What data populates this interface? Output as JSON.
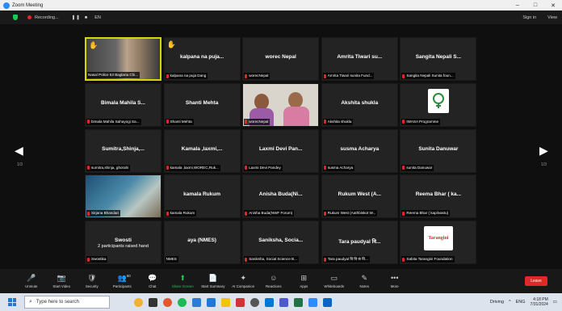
{
  "window": {
    "title": "Zoom Meeting",
    "controls": [
      "–",
      "□",
      "✕"
    ]
  },
  "topbar": {
    "recording": "Recording...",
    "pause": "❚❚",
    "stop": "■",
    "lang": "EN",
    "signin": "Sign in",
    "view": "View"
  },
  "tiles": [
    {
      "name": "",
      "label": "Nasal Police 53 Baglaria Chi...",
      "hand": "✋",
      "video": "person-brown",
      "active": true,
      "muted": false
    },
    {
      "name": "kalpana na puja...",
      "label": "kalpana na puja Dang",
      "hand": "✋",
      "muted": true
    },
    {
      "name": "worec Nepal",
      "label": "worecNepal",
      "muted": true
    },
    {
      "name": "Amrita Tiwari su...",
      "label": "Amrita Tiwari sunita Fund...",
      "muted": true
    },
    {
      "name": "Sangita Nepali S...",
      "label": "Sangita Nepali Sunita foun...",
      "muted": true
    },
    {
      "name": "Bimala Mahila S...",
      "label": "bimala Mahila Sahayogi Sa...",
      "muted": true
    },
    {
      "name": "Shanti Mehta",
      "label": "Shanti Mehta",
      "muted": true
    },
    {
      "name": "",
      "label": "worecNepal",
      "video": "two-women",
      "muted": true
    },
    {
      "name": "Akshita shukla",
      "label": "Akshita shukla",
      "muted": true
    },
    {
      "name": "",
      "label": "IWASA Programme",
      "logo": "iwasa",
      "muted": true
    },
    {
      "name": "Sumitra,Shinja,...",
      "label": "sumitra,shinja, ghorahi",
      "muted": true
    },
    {
      "name": "Kamala ,laxmi,...",
      "label": "kamala ,laxmi,WOREC,Ruk...",
      "muted": true
    },
    {
      "name": "Laxmi Devi Pan...",
      "label": "Laxmi Devi Pandey",
      "muted": true
    },
    {
      "name": "susma Acharya",
      "label": "susma Acharya",
      "muted": true
    },
    {
      "name": "Sunita Danuwar",
      "label": "sunita Danuwar",
      "muted": true
    },
    {
      "name": "",
      "label": "Sirjana Bhandari",
      "video": "room-blue",
      "muted": true
    },
    {
      "name": "kamala Rukum",
      "label": "kamala Rukum",
      "muted": true
    },
    {
      "name": "Anisha Buda(Ni...",
      "label": "Anisha Buda(NWF Forum)",
      "muted": true
    },
    {
      "name": "Rukum West (A...",
      "label": "Rukum West (Aathbiskot W...",
      "muted": true
    },
    {
      "name": "Reema Bhar ( ka...",
      "label": "Reema Bhar ( kapilvastu)",
      "muted": true
    },
    {
      "name": "Swosti",
      "label": "Swostika",
      "muted": true,
      "raise": "2 participants raised hand"
    },
    {
      "name": "aya (NMES)",
      "label": "NMES",
      "muted": false
    },
    {
      "name": "Saniksha, Socia...",
      "label": "Saniksha, Social Science B...",
      "muted": true
    },
    {
      "name": "Tara paudyal वि...",
      "label": "Tara paudyal वि वि कं वि...",
      "muted": true
    },
    {
      "name": "",
      "label": "Sabita Tarangini Foundation",
      "logo": "tarangini",
      "muted": true
    }
  ],
  "tarangini_logo": "Tarangini",
  "nav": {
    "left_page": "1/3",
    "right_page": "1/3"
  },
  "toolbar": [
    {
      "icon": "mic-icon",
      "glyph": "🎤",
      "label": "Unmute"
    },
    {
      "icon": "video-icon",
      "glyph": "📷",
      "label": "Start Video"
    },
    {
      "icon": "security-icon",
      "glyph": "🛡",
      "label": "Security"
    },
    {
      "icon": "participants-icon",
      "glyph": "👥",
      "label": "Participants",
      "count": "60"
    },
    {
      "icon": "chat-icon",
      "glyph": "💬",
      "label": "Chat"
    },
    {
      "icon": "share-screen-icon",
      "glyph": "⬆",
      "label": "Share Screen",
      "green": true
    },
    {
      "icon": "summary-icon",
      "glyph": "📄",
      "label": "Start Summary"
    },
    {
      "icon": "ai-companion-icon",
      "glyph": "✦",
      "label": "AI Companion"
    },
    {
      "icon": "reactions-icon",
      "glyph": "☺",
      "label": "Reactions"
    },
    {
      "icon": "apps-icon",
      "glyph": "⊞",
      "label": "Apps"
    },
    {
      "icon": "whiteboards-icon",
      "glyph": "▭",
      "label": "Whiteboards"
    },
    {
      "icon": "notes-icon",
      "glyph": "✎",
      "label": "Notes"
    },
    {
      "icon": "more-icon",
      "glyph": "•••",
      "label": "More"
    }
  ],
  "leave_label": "Leave",
  "taskbar": {
    "search_placeholder": "Type here to search",
    "weather": "Driving",
    "lang": "ENG",
    "time": "4:18 PM",
    "date": "7/31/2024"
  },
  "colors": {
    "active_border": "#d8d800",
    "mute_red": "#e02828",
    "leave_red": "#e02828",
    "share_green": "#23c552"
  }
}
